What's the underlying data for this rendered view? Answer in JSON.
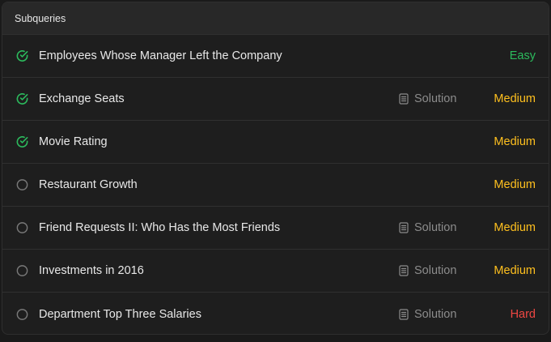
{
  "header": {
    "title": "Subqueries"
  },
  "colors": {
    "solved": "#2cbb5d",
    "unsolved": "#7a7a7a",
    "easy": "#2cbb5d",
    "medium": "#ffc01e",
    "hard": "#ef4743"
  },
  "solution_label": "Solution",
  "problems": [
    {
      "title": "Employees Whose Manager Left the Company",
      "status": "solved",
      "has_solution": false,
      "difficulty": "Easy"
    },
    {
      "title": "Exchange Seats",
      "status": "solved",
      "has_solution": true,
      "difficulty": "Medium"
    },
    {
      "title": "Movie Rating",
      "status": "solved",
      "has_solution": false,
      "difficulty": "Medium"
    },
    {
      "title": "Restaurant Growth",
      "status": "unsolved",
      "has_solution": false,
      "difficulty": "Medium"
    },
    {
      "title": "Friend Requests II: Who Has the Most Friends",
      "status": "unsolved",
      "has_solution": true,
      "difficulty": "Medium"
    },
    {
      "title": "Investments in 2016",
      "status": "unsolved",
      "has_solution": true,
      "difficulty": "Medium"
    },
    {
      "title": "Department Top Three Salaries",
      "status": "unsolved",
      "has_solution": true,
      "difficulty": "Hard"
    }
  ]
}
